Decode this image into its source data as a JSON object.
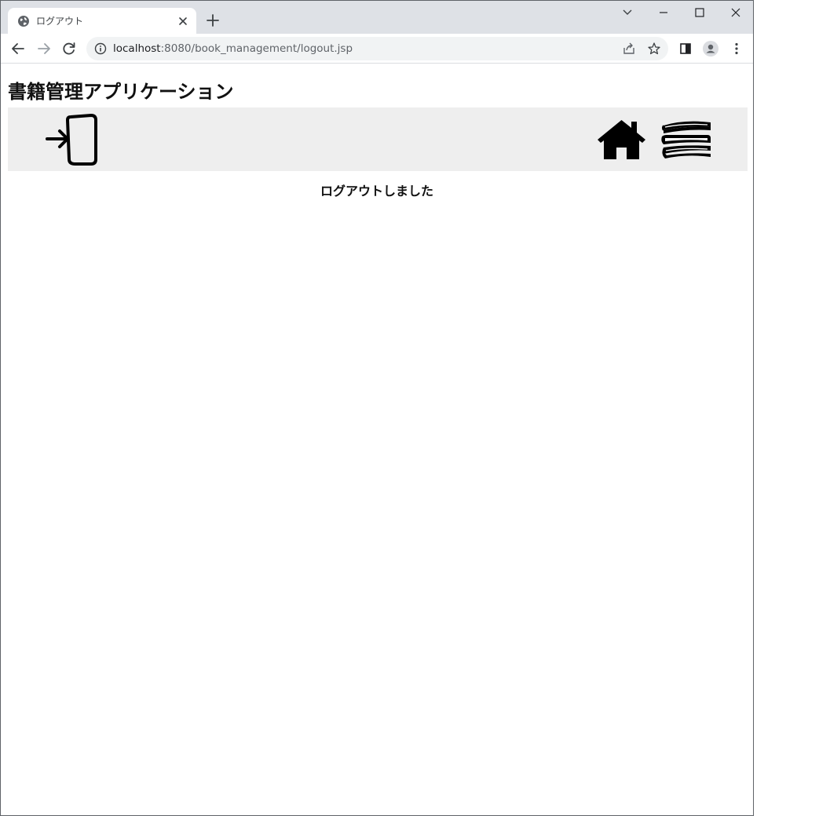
{
  "browser": {
    "tab": {
      "title": "ログアウト"
    },
    "address_bar": {
      "host": "localhost",
      "path": ":8080/book_management/logout.jsp"
    }
  },
  "page": {
    "app_title": "書籍管理アプリケーション",
    "navbar": {
      "background": "#eeeeee",
      "icons": [
        "login-icon",
        "home-icon",
        "books-icon"
      ]
    },
    "message": "ログアウトしました"
  }
}
